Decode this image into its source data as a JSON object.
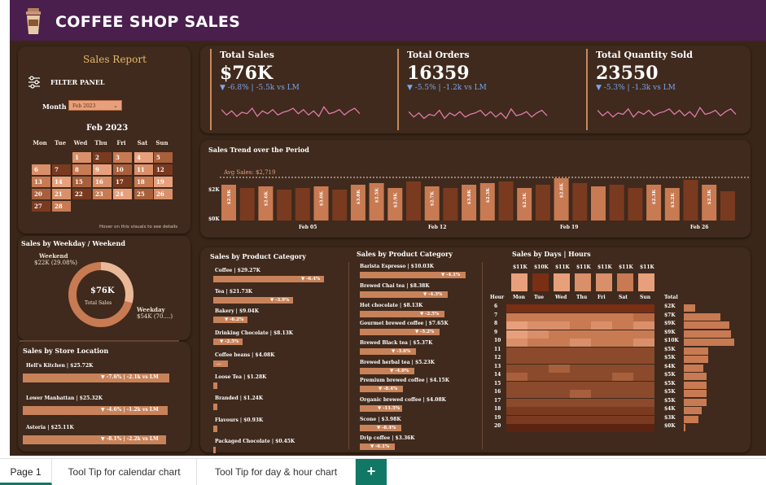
{
  "app": {
    "title": "COFFEE SHOP SALES"
  },
  "left": {
    "sales_report": "Sales Report",
    "filter_panel": "FILTER PANEL",
    "month_label": "Month",
    "month_value": "Feb 2023",
    "calendar": {
      "title": "Feb 2023",
      "weekdays": [
        "Mon",
        "Tue",
        "Wed",
        "Thu",
        "Fri",
        "Sat",
        "Sun"
      ],
      "hint": "Hover on this visuals to see details",
      "days": [
        "1",
        "2",
        "3",
        "4",
        "5",
        "6",
        "7",
        "8",
        "9",
        "10",
        "11",
        "12",
        "13",
        "14",
        "15",
        "16",
        "17",
        "18",
        "19",
        "20",
        "21",
        "22",
        "23",
        "24",
        "25",
        "26",
        "27",
        "28"
      ]
    },
    "weekday_title": "Sales by Weekday / Weekend",
    "weekend_label": "Weekend",
    "weekend_value": "$22K (29.08%)",
    "weekday_label": "Weekday",
    "weekday_value": "$54K (70....)",
    "donut_value": "$76K",
    "donut_label": "Total Sales",
    "store_title": "Sales by Store Location",
    "stores": [
      {
        "label": "Hell's Kitchen | $25.72K",
        "delta": "▼ -7.6% | -2.1k vs LM"
      },
      {
        "label": "Lower Manhattan | $25.32K",
        "delta": "▼ -4.6% | -1.2k vs LM"
      },
      {
        "label": "Astoria | $25.11K",
        "delta": "▼ -8.1% | -2.2k vs LM"
      }
    ]
  },
  "kpis": [
    {
      "title": "Total Sales",
      "value": "$76K",
      "delta": "▼ -6.8% | -5.5k vs LM"
    },
    {
      "title": "Total Orders",
      "value": "16359",
      "delta": "▼ -5.5% | -1.2k vs LM"
    },
    {
      "title": "Total Quantity Sold",
      "value": "23550",
      "delta": "▼ -5.3% | -1.3k vs LM"
    }
  ],
  "trend": {
    "title": "Sales Trend over the Period",
    "avg_label": "Avg Sales: $2,719",
    "y_ticks": [
      "$2K",
      "$0K"
    ],
    "x_ticks": [
      "Feb 05",
      "Feb 12",
      "Feb 19",
      "Feb 26"
    ],
    "bar_labels": [
      "$2.9K",
      "",
      "$2.6K",
      "",
      "",
      "$3.0K",
      "",
      "$3.0K",
      "$2.5K",
      "$2.9K",
      "",
      "$2.7K",
      "",
      "$3.0K",
      "$2.3K",
      "",
      "$2.3K",
      "",
      "$2.8K",
      "",
      "",
      "",
      "",
      "$2.3K",
      "$3.2K",
      "",
      "$2.3K",
      ""
    ]
  },
  "categories1": {
    "title": "Sales by Product Category",
    "items": [
      {
        "label": "Coffee | $29.27K",
        "delta": "▼ -6.4%"
      },
      {
        "label": "Tea | $21.73K",
        "delta": "▼ -3.9%"
      },
      {
        "label": "Bakery | $9.04K",
        "delta": "▼ -6.2%"
      },
      {
        "label": "Drinking Chocolate | $8.13K",
        "delta": "▼ -2.5%"
      },
      {
        "label": "Coffee beans | $4.08K",
        "delta": "..."
      },
      {
        "label": "Loose Tea | $1.28K",
        "delta": ""
      },
      {
        "label": "Branded | $1.24K",
        "delta": ""
      },
      {
        "label": "Flavours | $0.93K",
        "delta": ""
      },
      {
        "label": "Packaged Chocolate | $0.45K",
        "delta": ""
      }
    ]
  },
  "categories2": {
    "title": "Sales by Product Category",
    "items": [
      {
        "label": "Barista Espresso | $10.03K",
        "delta": "▼ -4.1%"
      },
      {
        "label": "Brewed Chai tea | $8.38K",
        "delta": "▼ -4.3%"
      },
      {
        "label": "Hot chocolate | $8.13K",
        "delta": "▼ -2.5%"
      },
      {
        "label": "Gourmet brewed coffee | $7.65K",
        "delta": "▼ -5.2%"
      },
      {
        "label": "Brewed Black tea | $5.37K",
        "delta": "▼ -3.6%"
      },
      {
        "label": "Brewed herbal tea | $5.23K",
        "delta": "▼ -4.0%"
      },
      {
        "label": "Premium brewed coffee | $4.15K",
        "delta": "▼ -8.4%"
      },
      {
        "label": "Organic brewed coffee | $4.08K",
        "delta": "▼ -11.5%"
      },
      {
        "label": "Scone | $3.98K",
        "delta": "▼ -8.4%"
      },
      {
        "label": "Drip coffee | $3.36K",
        "delta": "▼ -6.1%"
      }
    ]
  },
  "heatmap": {
    "title": "Sales by Days | Hours",
    "day_values": [
      "$11K",
      "$10K",
      "$11K",
      "$11K",
      "$11K",
      "$11K",
      "$11K"
    ],
    "days": [
      "Mon",
      "Tue",
      "Wed",
      "Thu",
      "Fri",
      "Sat",
      "Sun"
    ],
    "hour_label": "Hour",
    "total_label": "Total",
    "hours": [
      "6",
      "7",
      "8",
      "9",
      "10",
      "11",
      "12",
      "13",
      "14",
      "15",
      "16",
      "17",
      "18",
      "19",
      "20"
    ],
    "totals": [
      "$2K",
      "$7K",
      "$9K",
      "$9K",
      "$10K",
      "$5K",
      "$5K",
      "$4K",
      "$5K",
      "$5K",
      "$5K",
      "$5K",
      "$4K",
      "$3K",
      "$0K"
    ]
  },
  "tabs": [
    "Page 1",
    "Tool Tip for calendar chart",
    "Tool Tip for day & hour chart"
  ],
  "tab_add": "+"
}
